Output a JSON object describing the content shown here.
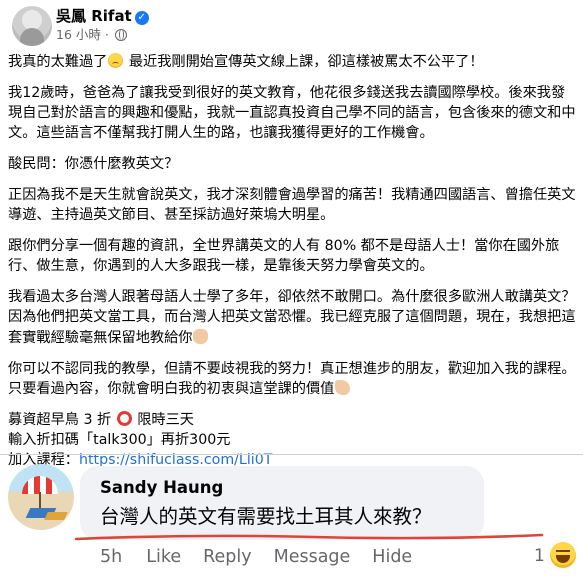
{
  "post": {
    "author": "吳鳳 Rifat",
    "time": "16 小時",
    "paragraphs": [
      {
        "text": "我真的太難過了",
        "emoji": "sad-face-icon",
        "text2": " 最近我剛開始宣傳英文線上課，卻這樣被罵太不公平了！"
      },
      {
        "text": "我12歲時，爸爸為了讓我受到很好的英文教育，他花很多錢送我去讀國際學校。後來我發現自己對於語言的興趣和優點，我就一直認真投資自己學不同的語言，包含後來的德文和中文。這些語言不僅幫我打開人生的路，也讓我獲得更好的工作機會。"
      },
      {
        "text": "酸民問：你憑什麼教英文？"
      },
      {
        "text": "正因為我不是天生就會說英文，我才深刻體會過學習的痛苦！我精通四國語言、曾擔任英文導遊、主持過英文節目、甚至採訪過好萊塢大明星。"
      },
      {
        "text": "跟你們分享一個有趣的資訊，全世界講英文的人有 80% 都不是母語人士！當你在國外旅行、做生意，你遇到的人大多跟我一樣，是靠後天努力學會英文的。"
      },
      {
        "text": "我看過太多台灣人跟著母語人士學了多年，卻依然不敢開口。為什麼很多歐洲人敢講英文？因為他們把英文當工具，而台灣人把英文當恐懼。我已經克服了這個問題，現在，我想把這套實戰經驗毫無保留地教給你"
      },
      {
        "text": "你可以不認同我的教學，但請不要歧視我的努力！真正想進步的朋友，歡迎加入我的課程。 只要看過內容，你就會明白我的初衷與這堂課的價值"
      }
    ],
    "promo": {
      "line1a": "募資超早鳥 3 折",
      "line1b": " 限時三天",
      "line2": "輸入折扣碼「talk300」再折300元",
      "line3_label": "加入課程：",
      "line3_link": "https://shifuclass.com/Lli0T"
    }
  },
  "comment": {
    "name": "Sandy Haung",
    "text": "台灣人的英文有需要找土耳其人來教？",
    "time": "5h",
    "like": "Like",
    "reply": "Reply",
    "message": "Message",
    "hide": "Hide",
    "reaction_count": "1"
  },
  "colors": {
    "link": "#216fdb",
    "underline": "#e0433a",
    "verified": "#1877f2"
  }
}
